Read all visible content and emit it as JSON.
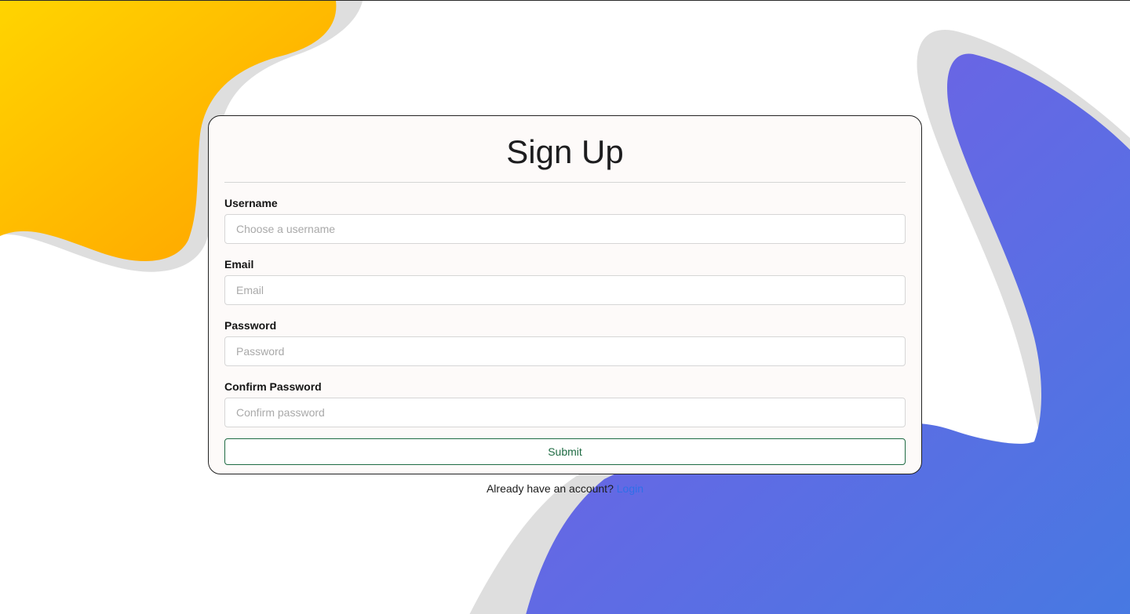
{
  "page": {
    "title": "Sign Up"
  },
  "form": {
    "fields": [
      {
        "label": "Username",
        "placeholder": "Choose a username",
        "value": ""
      },
      {
        "label": "Email",
        "placeholder": "Email",
        "value": ""
      },
      {
        "label": "Password",
        "placeholder": "Password",
        "value": ""
      },
      {
        "label": "Confirm Password",
        "placeholder": "Confirm password",
        "value": ""
      }
    ],
    "submit_label": "Submit"
  },
  "footer": {
    "prompt": "Already have an account?",
    "link_label": "Login"
  },
  "colors": {
    "yellow_start": "#ffd400",
    "yellow_end": "#ffa000",
    "purple_start": "#7b5be6",
    "purple_end": "#4779e2",
    "shadow_gray": "#dedede",
    "submit_green": "#1f6b43",
    "link_blue": "#2f6fe8"
  }
}
